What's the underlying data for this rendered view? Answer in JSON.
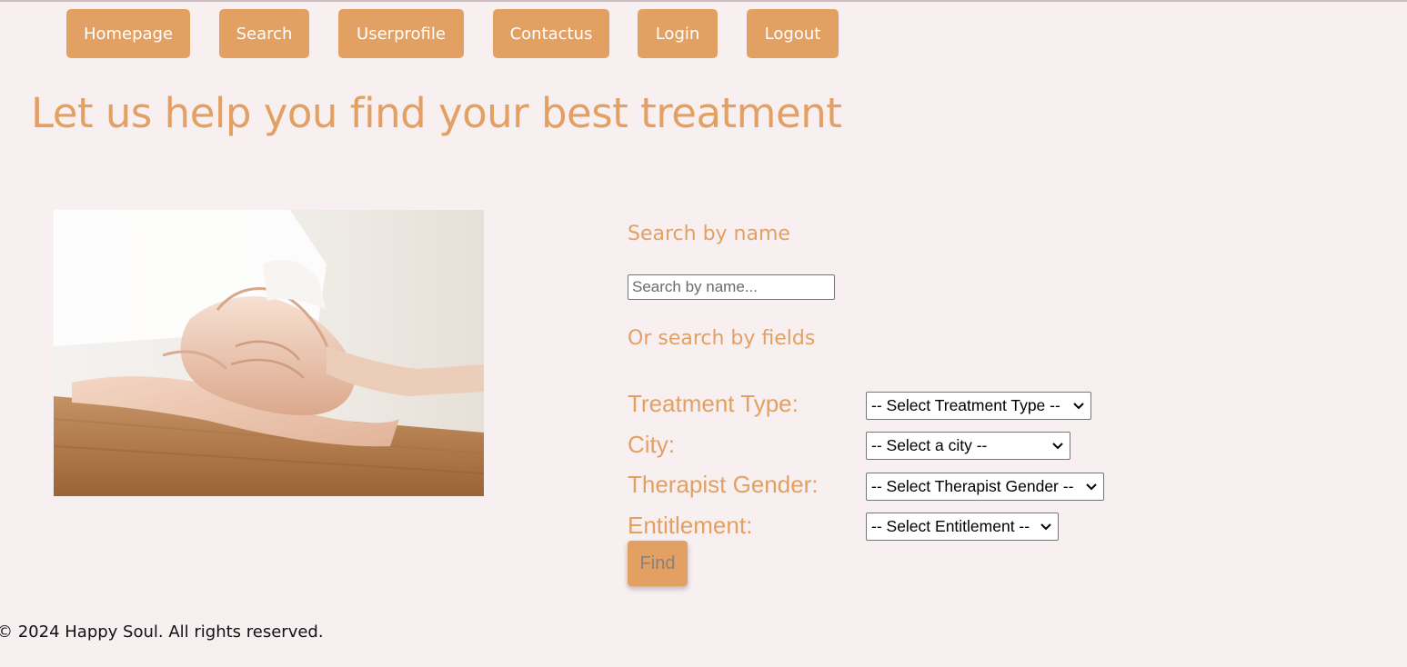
{
  "nav": {
    "items": [
      "Homepage",
      "Search",
      "Userprofile",
      "Contactus",
      "Login",
      "Logout"
    ]
  },
  "page": {
    "title": "Let us help you find your best treatment"
  },
  "search": {
    "by_name_heading": "Search by name",
    "name_placeholder": "Search by name...",
    "by_fields_heading": "Or search by fields",
    "fields": [
      {
        "label": "Treatment Type:",
        "selected": "-- Select Treatment Type --"
      },
      {
        "label": "City:",
        "selected": "-- Select a city --"
      },
      {
        "label": "Therapist Gender:",
        "selected": "-- Select Therapist Gender --"
      },
      {
        "label": "Entitlement:",
        "selected": "-- Select Entitlement --"
      }
    ],
    "find_label": "Find"
  },
  "footer": {
    "text": "© 2024 Happy Soul. All rights reserved."
  },
  "colors": {
    "accent": "#e3a063",
    "background": "#f8eff1"
  },
  "icons": [
    "chevron-down-icon"
  ]
}
